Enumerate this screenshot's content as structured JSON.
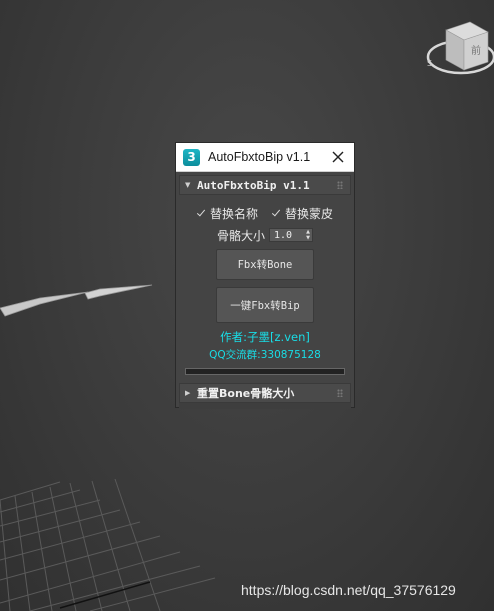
{
  "dialog": {
    "app_icon_text": "3",
    "title": "AutoFbxtoBip v1.1",
    "rollout_main": {
      "label": "AutoFbxtoBip v1.1",
      "checkbox_rename": {
        "label": "替换名称",
        "checked": true
      },
      "checkbox_skin": {
        "label": "替换蒙皮",
        "checked": true
      },
      "bone_size": {
        "label": "骨骼大小",
        "value": "1.0"
      },
      "button_fbx_to_bone": "Fbx转Bone",
      "button_fbx_to_bip": "一键Fbx转Bip",
      "author": "作者:子墨[z.ven]",
      "qq_group": "QQ交流群:330875128",
      "progress": 0,
      "accent_color": "#19dde6"
    },
    "rollout_reset": {
      "label": "重置Bone骨骼大小",
      "expanded": false
    }
  },
  "viewcube": {
    "face_label": "前"
  },
  "watermark": "https://blog.csdn.net/qq_37576129",
  "icons": {
    "close": "close-icon",
    "expand": "triangle-down-icon",
    "collapse": "triangle-right-icon",
    "spinner": "spinner-arrows-icon"
  }
}
